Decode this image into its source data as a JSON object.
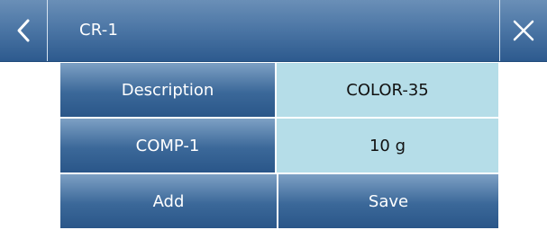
{
  "header": {
    "title": "CR-1",
    "back_icon": "chevron-left-icon",
    "close_icon": "close-icon"
  },
  "rows": [
    {
      "label": "Description",
      "value": "COLOR-35"
    },
    {
      "label": "COMP-1",
      "value": "10 g"
    }
  ],
  "actions": {
    "add_label": "Add",
    "save_label": "Save"
  },
  "colors": {
    "header_gradient_top": "#6a8fb7",
    "header_gradient_bottom": "#2d5a8e",
    "value_background": "#b5dde8",
    "text_on_blue": "#ffffff"
  }
}
